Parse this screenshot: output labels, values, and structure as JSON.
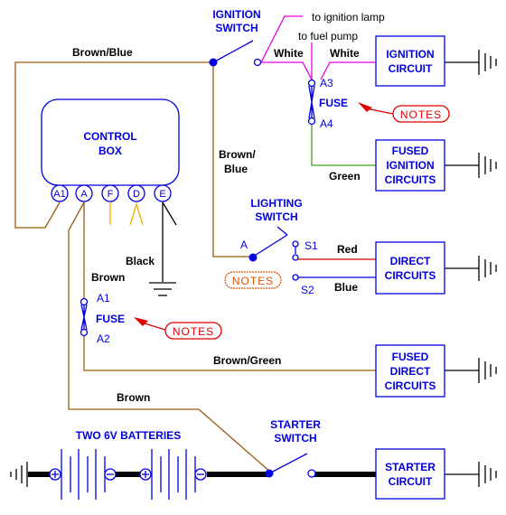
{
  "colors": {
    "label_blue": "#0000e0",
    "brown_wire": "#9a5a10",
    "white_wire": "#e000e0",
    "green_wire": "#40a020",
    "red_wire": "#e00000",
    "blue_wire": "#0000e0",
    "yellow_wire": "#f0b000",
    "notes_red": "#e00000",
    "notes_orange": "#e05000"
  },
  "control_box": {
    "label_line1": "CONTROL",
    "label_line2": "BOX",
    "terminals": [
      "A1",
      "A",
      "F",
      "D",
      "E"
    ]
  },
  "ignition_switch": {
    "line1": "IGNITION",
    "line2": "SWITCH"
  },
  "lighting_switch": {
    "line1": "LIGHTING",
    "line2": "SWITCH",
    "pivot_label": "A",
    "contact1": "S1",
    "contact2": "S2"
  },
  "starter_switch": {
    "line1": "STARTER",
    "line2": "SWITCH"
  },
  "batteries": {
    "label": "TWO 6V BATTERIES"
  },
  "fuses": [
    {
      "label": "FUSE",
      "top_terminal": "A3",
      "bottom_terminal": "A4",
      "notes": "NOTES"
    },
    {
      "label": "FUSE",
      "top_terminal": "A1",
      "bottom_terminal": "A2",
      "notes": "NOTES"
    }
  ],
  "lighting_notes": "NOTES",
  "circuits": {
    "ignition": {
      "line1": "IGNITION",
      "line2": "CIRCUIT"
    },
    "fused_ignition": {
      "line1": "FUSED",
      "line2": "IGNITION",
      "line3": "CIRCUITS"
    },
    "direct": {
      "line1": "DIRECT",
      "line2": "CIRCUITS"
    },
    "fused_direct": {
      "line1": "FUSED",
      "line2": "DIRECT",
      "line3": "CIRCUITS"
    },
    "starter": {
      "line1": "STARTER",
      "line2": "CIRCUIT"
    }
  },
  "wire_labels": {
    "brown_blue_top": "Brown/Blue",
    "brown_blue_vertical_1": "Brown/",
    "brown_blue_vertical_2": "Blue",
    "white_left": "White",
    "white_right": "White",
    "green": "Green",
    "to_ignition_lamp": "to ignition lamp",
    "to_fuel_pump": "to fuel pump",
    "black": "Black",
    "brown_fuse": "Brown",
    "red": "Red",
    "blue": "Blue",
    "brown_green": "Brown/Green",
    "brown_starter": "Brown"
  }
}
